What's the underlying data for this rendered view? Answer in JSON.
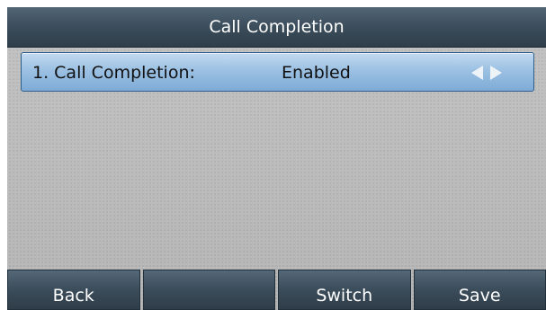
{
  "title_bar": {
    "title": "Call Completion"
  },
  "item": {
    "label": "1. Call Completion:",
    "value": "Enabled",
    "left_arrow_icon": "triangle-left-icon",
    "right_arrow_icon": "triangle-right-icon"
  },
  "softkeys": [
    {
      "label": "Back"
    },
    {
      "label": ""
    },
    {
      "label": "Switch"
    },
    {
      "label": "Save"
    }
  ],
  "colors": {
    "title_bar": "#3a4b59",
    "selected_row": "#9cc1e3",
    "softkey": "#3b4c5a",
    "background": "#b6b6b6"
  }
}
